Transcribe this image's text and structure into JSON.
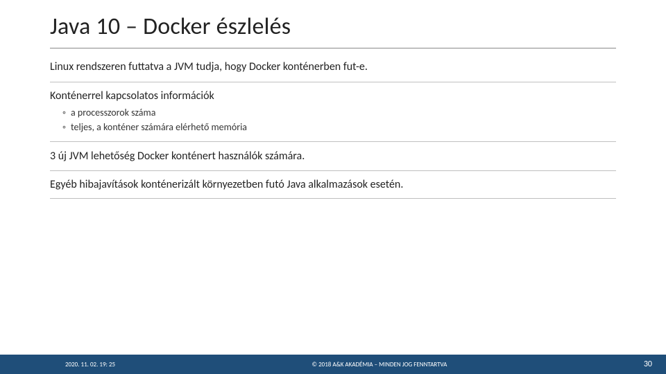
{
  "slide": {
    "title": "Java 10 – Docker észlelés",
    "paragraphs": {
      "p1": "Linux rendszeren futtatva a JVM tudja, hogy Docker konténerben fut-e.",
      "p2_head": "Konténerrel kapcsolatos információk",
      "p2_bullets": {
        "b1": "a processzorok száma",
        "b2": "teljes, a konténer számára elérhető memória"
      },
      "p3": "3 új JVM lehetőség Docker konténert használók számára.",
      "p4": "Egyéb hibajavítások konténerizált környezetben futó Java alkalmazások esetén."
    }
  },
  "footer": {
    "timestamp": "2020. 11. 02. 19: 25",
    "copyright": "© 2018 A&K AKADÉMIA – MINDEN JOG FENNTARTVA",
    "page": "30"
  }
}
